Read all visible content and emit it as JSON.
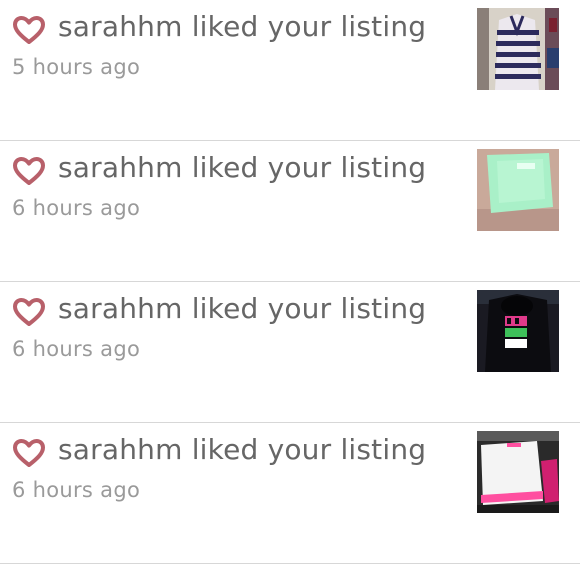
{
  "notifications": [
    {
      "username": "sarahhm",
      "message": "liked your listing",
      "time": "5 hours ago",
      "thumbnail": "striped-sweater-photo"
    },
    {
      "username": "sarahhm",
      "message": "liked your listing",
      "time": "6 hours ago",
      "thumbnail": "mint-top-photo"
    },
    {
      "username": "sarahhm",
      "message": "liked your listing",
      "time": "6 hours ago",
      "thumbnail": "los-angeles-hoodie-photo"
    },
    {
      "username": "sarahhm",
      "message": "liked your listing",
      "time": "6 hours ago",
      "thumbnail": "white-pink-tee-photo"
    }
  ],
  "colors": {
    "heart": "#b8606a",
    "text": "#666666",
    "time": "#9a9a9a",
    "divider": "#d7d7d7"
  },
  "icons": {
    "like": "heart-outline-icon"
  }
}
